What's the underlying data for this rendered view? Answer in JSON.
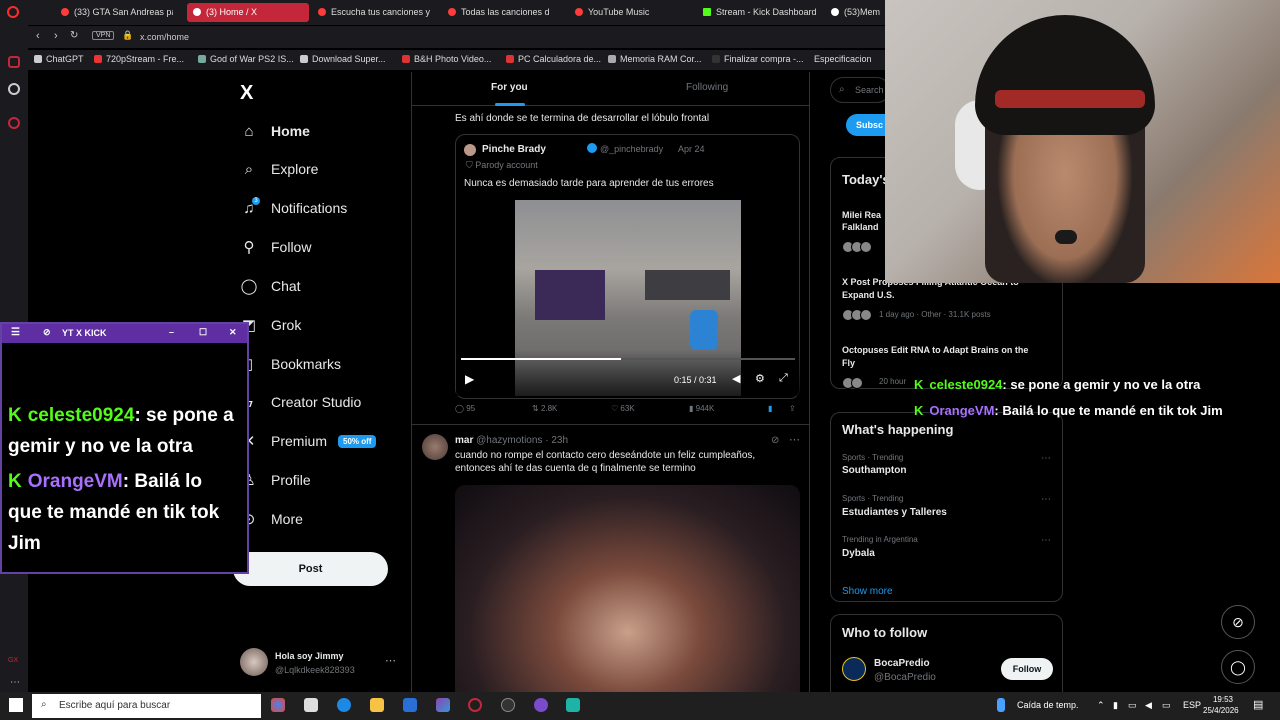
{
  "browser": {
    "tabs": [
      {
        "label": "(33) GTA San Andreas pa",
        "color": "#ff3b3b"
      },
      {
        "label": "(3) Home / X",
        "color": "#ffffff"
      },
      {
        "label": "Escucha tus canciones y",
        "color": "#ff3b3b"
      },
      {
        "label": "Todas las canciones d",
        "color": "#ff3b3b"
      },
      {
        "label": "YouTube Music",
        "color": "#ff3b3b"
      },
      {
        "label": "Stream - Kick Dashboard",
        "color": "#53fc18"
      },
      {
        "label": "(53)Mem",
        "color": "#ffffff"
      }
    ],
    "address": "x.com/home",
    "vpn_label": "VPN",
    "bookmarks": [
      "ChatGPT",
      "720pStream - Fre...",
      "God of War PS2 IS...",
      "Download Super...",
      "B&H Photo Video...",
      "PC Calculadora de...",
      "Memoria RAM Cor...",
      "Finalizar compra -...",
      "Especificacion"
    ]
  },
  "sidebar": {
    "logo": "X",
    "items": [
      {
        "label": "Home",
        "icon": "home-icon"
      },
      {
        "label": "Explore",
        "icon": "search-icon"
      },
      {
        "label": "Notifications",
        "icon": "bell-icon"
      },
      {
        "label": "Follow",
        "icon": "person-add-icon"
      },
      {
        "label": "Chat",
        "icon": "chat-icon"
      },
      {
        "label": "Grok",
        "icon": "grok-icon"
      },
      {
        "label": "Bookmarks",
        "icon": "bookmark-icon"
      },
      {
        "label": "Creator Studio",
        "icon": "lightning-icon"
      },
      {
        "label": "Premium",
        "icon": "x-icon"
      },
      {
        "label": "Profile",
        "icon": "person-icon"
      },
      {
        "label": "More",
        "icon": "more-icon"
      }
    ],
    "notif_count": "3",
    "premium_badge": "50% off",
    "post_label": "Post",
    "profile": {
      "name": "Hola soy Jimmy",
      "handle": "@Lqlkdkeek828393"
    }
  },
  "overlay": {
    "title": "YT X KICK",
    "messages": [
      {
        "user": "celeste0924",
        "text": ": se pone a gemir y no ve la otra"
      },
      {
        "user": "OrangeVM",
        "text": ": Bailá lo que te mandé en tik tok Jim"
      }
    ]
  },
  "feed": {
    "tabs": [
      "For you",
      "Following"
    ],
    "tweet1": {
      "text": "Es ahí donde se te termina de desarrollar el lóbulo frontal",
      "quote": {
        "name": "Pinche Brady",
        "handle": "@_pinchebrady",
        "date": "Apr 24",
        "label": "Parody account",
        "text": "Nunca es demasiado tarde para aprender de tus errores"
      },
      "video_time": "0:15 / 0:31",
      "actions": {
        "replies": "95",
        "reposts": "2.8K",
        "likes": "63K",
        "views": "944K"
      }
    },
    "tweet2": {
      "name": "mar",
      "handle": "@hazymotions",
      "time": "23h",
      "text": "cuando no rompe el contacto cero deseándote un feliz cumpleaños, entonces ahí te das cuenta de q finalmente se termino"
    }
  },
  "right": {
    "search_placeholder": "Search",
    "subscribe": "Subsc",
    "today_title": "Today's",
    "news": [
      {
        "title": "Milei Rea",
        "title2": "Falkland",
        "meta": ""
      },
      {
        "title": "X Post Proposes Filling Atlantic Ocean to",
        "title2": "Expand U.S.",
        "meta": "1 day ago · Other · 31.1K posts"
      },
      {
        "title": "Octopuses Edit RNA to Adapt Brains on the",
        "title2": "Fly",
        "meta": "20 hour"
      }
    ],
    "happening_title": "What's happening",
    "trends": [
      {
        "category": "Sports · Trending",
        "topic": "Southampton"
      },
      {
        "category": "Sports · Trending",
        "topic": "Estudiantes y Talleres"
      },
      {
        "category": "Trending in Argentina",
        "topic": "Dybala"
      }
    ],
    "show_more": "Show more",
    "who_title": "Who to follow",
    "suggest": {
      "name": "BocaPredio",
      "handle": "@BocaPredio",
      "button": "Follow"
    }
  },
  "stream_chat": [
    {
      "user": "celeste0924",
      "text": ": se pone a gemir y no ve la otra"
    },
    {
      "user": "OrangeVM",
      "text": ": Bailá lo que te mandé en tik tok Jim"
    }
  ],
  "taskbar": {
    "search": "Escribe aquí para buscar",
    "weather": "Caída de temp.",
    "lang": "ESP",
    "time": "19:53",
    "date": "25/4/2026"
  }
}
